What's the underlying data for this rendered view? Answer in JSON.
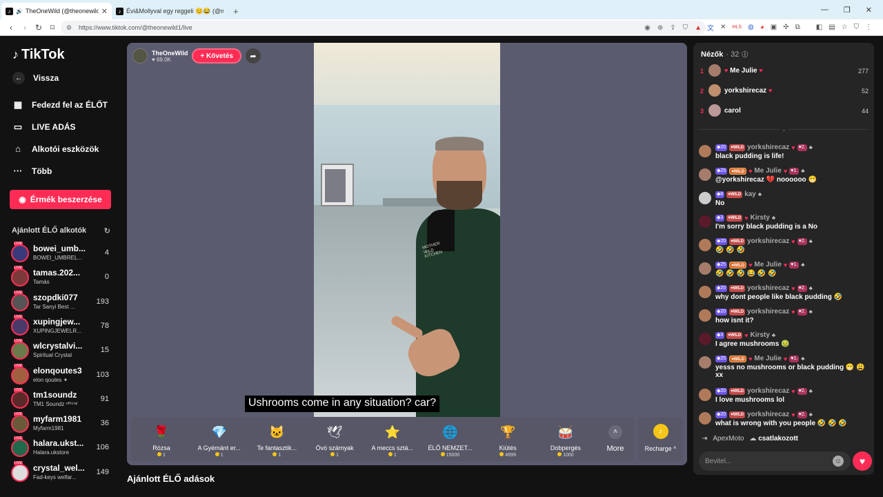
{
  "browser": {
    "tabs": [
      {
        "title": "TheOneWild (@theonewild1)",
        "close": "✕"
      },
      {
        "title": "Évi&Mollyval egy reggeli 😊😂 (@m",
        "close": ""
      }
    ],
    "new_tab": "+",
    "url": "https://www.tiktok.com/@theonewild1/live"
  },
  "sidebar": {
    "logo": "TikTok",
    "back": "Vissza",
    "nav": [
      {
        "label": "Fedezd fel az ÉLŐT",
        "icon": "calendar-icon"
      },
      {
        "label": "LIVE ADÁS",
        "icon": "camera-icon"
      },
      {
        "label": "Alkotói eszközök",
        "icon": "home-tools-icon"
      },
      {
        "label": "Több",
        "icon": "more-icon"
      }
    ],
    "coins_button": "Érmék beszerzése",
    "recommended_title": "Ajánlott ÉLŐ alkotók",
    "creators": [
      {
        "name": "bowei_umb...",
        "sub": "BOWEI_UMBREL...",
        "count": "4",
        "color": "#3a3a7a"
      },
      {
        "name": "tamas.202...",
        "sub": "Tamás",
        "count": "0",
        "color": "#7a3a3a"
      },
      {
        "name": "szopdki077",
        "sub": "Tar Sanyi Best ...",
        "count": "193",
        "color": "#555"
      },
      {
        "name": "xupingjew...",
        "sub": "XUPINGJEWELR...",
        "count": "78",
        "color": "#4a3a6a"
      },
      {
        "name": "wlcrystalvi...",
        "sub": "Spiritual Crystal",
        "count": "15",
        "color": "#6a7a4a"
      },
      {
        "name": "elonqoutes3",
        "sub": "elon qoutes ✦",
        "count": "103",
        "color": "#a06040"
      },
      {
        "name": "tm1soundz",
        "sub": "TM1 Soundz ᵒᶠᶠⁱᶜⁱᵃˡ",
        "count": "91",
        "color": "#5a2a2a"
      },
      {
        "name": "myfarm1981",
        "sub": "Myfarm1981",
        "count": "36",
        "color": "#6a5a3a"
      },
      {
        "name": "halara.ukst...",
        "sub": "Halara.ukstore",
        "count": "106",
        "color": "#1e6a4a"
      },
      {
        "name": "crystal_wel...",
        "sub": "Fad-keys welfar...",
        "count": "149",
        "color": "#ddd"
      }
    ]
  },
  "player": {
    "host_name": "TheOneWild",
    "host_likes": "69.0K",
    "follow": "+ Követés",
    "caption": "Ushrooms come in any situation? car?",
    "apron_text": "MOTHER WILD KITCHEN",
    "gifts": [
      {
        "name": "Rózsa",
        "price": "1",
        "icon": "rose-icon",
        "glyph": "🌹"
      },
      {
        "name": "A Gyémánt er...",
        "price": "1",
        "icon": "diamond-icon",
        "glyph": "💎"
      },
      {
        "name": "Te fantasztik...",
        "price": "1",
        "icon": "cat-icon",
        "glyph": "🐱"
      },
      {
        "name": "Óvó szárnyak",
        "price": "1",
        "icon": "wings-icon",
        "glyph": "🕊"
      },
      {
        "name": "A meccs sztá...",
        "price": "1",
        "icon": "star-icon",
        "glyph": "⭐"
      },
      {
        "name": "ÉLŐ NEMZET...",
        "price": "15000",
        "icon": "globe-icon",
        "glyph": "🌐"
      },
      {
        "name": "Kiütés",
        "price": "4999",
        "icon": "trophy-icon",
        "glyph": "🏆"
      },
      {
        "name": "Dobpergés",
        "price": "1000",
        "icon": "drum-icon",
        "glyph": "🥁"
      }
    ],
    "more": "More",
    "recharge": "Recharge ^"
  },
  "recommended_streams_title": "Ajánlott ÉLŐ adások",
  "chat": {
    "viewers_label": "Nézők",
    "viewers_count": "· 32",
    "top": [
      {
        "rank": "1",
        "name": "Me Julie",
        "score": "277"
      },
      {
        "rank": "2",
        "name": "yorkshirecaz",
        "score": "52"
      },
      {
        "rank": "3",
        "name": "carol",
        "score": "44"
      }
    ],
    "messages": [
      {
        "lv": "20",
        "w": "WILD",
        "user": "yorkshirecaz",
        "g": "2",
        "text": "black pudding is life!"
      },
      {
        "lv": "25",
        "w": "WILD",
        "user": "Me Julie",
        "g": "1",
        "text": "@yorkshirecaz 💔 noooooo 😁"
      },
      {
        "lv": "8",
        "w": "WILD",
        "user": "kay",
        "g": "",
        "text": "No"
      },
      {
        "lv": "3",
        "w": "WILD",
        "user": "Kirsty",
        "g": "",
        "text": "I'm sorry black pudding is a No"
      },
      {
        "lv": "20",
        "w": "WILD",
        "user": "yorkshirecaz",
        "g": "2",
        "text": "🤣 🤣 🤣"
      },
      {
        "lv": "25",
        "w": "WILD",
        "user": "Me Julie",
        "g": "1",
        "text": "🤣 🤣 🤣 😂 🤣 🤣"
      },
      {
        "lv": "20",
        "w": "WILD",
        "user": "yorkshirecaz",
        "g": "2",
        "text": "why dont people like black pudding 🤣"
      },
      {
        "lv": "20",
        "w": "WILD",
        "user": "yorkshirecaz",
        "g": "2",
        "text": "how isnt it?"
      },
      {
        "lv": "3",
        "w": "WILD",
        "user": "Kirsty",
        "g": "",
        "text": "I agree mushrooms 🤢"
      },
      {
        "lv": "25",
        "w": "WILD",
        "user": "Me Julie",
        "g": "1",
        "text": "yesss no mushrooms or black pudding 😁 😩 xx"
      },
      {
        "lv": "20",
        "w": "WILD",
        "user": "yorkshirecaz",
        "g": "2",
        "text": "I love mushrooms lol"
      },
      {
        "lv": "20",
        "w": "WILD",
        "user": "yorkshirecaz",
        "g": "2",
        "text": "what is wrong with you people 🤣 🤣 🤣"
      }
    ],
    "join_user": "ApexMoto",
    "join_text": "csatlakozott",
    "input_placeholder": "Bevitel..."
  }
}
